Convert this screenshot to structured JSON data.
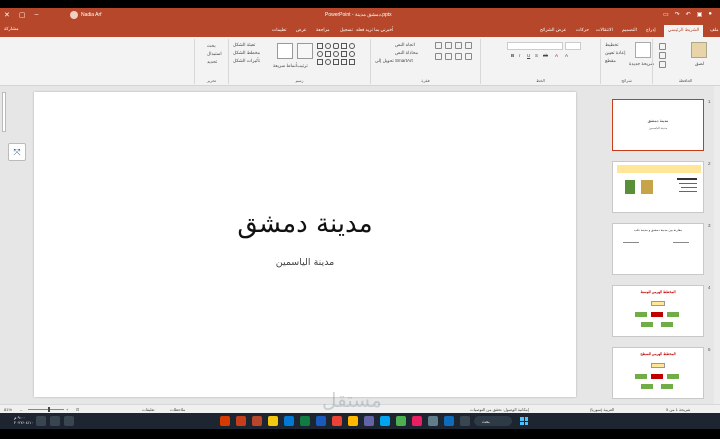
{
  "window": {
    "title": "PowerPoint - دمشق مدينة.pptx",
    "user_name": "Nadia Arf",
    "qat_icons": [
      "autosave-icon",
      "save-icon",
      "undo-icon",
      "redo-icon",
      "present-icon"
    ]
  },
  "tabs": {
    "items": [
      "ملف",
      "الشريط الرئيسي",
      "إدراج",
      "التصميم",
      "الانتقالات",
      "حركات",
      "عرض الشرائح",
      "تسجيل",
      "مراجعة",
      "عرض",
      "تعليمات"
    ],
    "tell_me": "أخبرني بما تريد فعله",
    "share": "مشاركة"
  },
  "ribbon": {
    "groups": [
      "الحافظة",
      "شرائح",
      "الخط",
      "فقرة",
      "رسم",
      "تحرير"
    ],
    "items": {
      "paste": "لصق",
      "new_slide": "شريحة جديدة",
      "layout": "تخطيط",
      "reset": "إعادة تعيين",
      "section": "مقطع",
      "find": "بحث",
      "replace": "استبدال",
      "select": "تحديد",
      "arrange": "ترتيب",
      "quick_styles": "أنماط سريعة",
      "shape_fill": "تعبئة الشكل",
      "shape_outline": "مخطط الشكل",
      "shape_effects": "تأثيرات الشكل",
      "text_direction": "اتجاه النص",
      "align_text": "محاذاة النص",
      "smartart": "تحويل إلى SmartArt"
    }
  },
  "slide": {
    "title": "مدينة دمشق",
    "subtitle": "مدينة الياسمين"
  },
  "thumbnails": [
    {
      "number": "1",
      "title": "مدينة دمشق",
      "subtitle": "مدينة الياسمين"
    },
    {
      "number": "2",
      "title": ""
    },
    {
      "number": "3",
      "title": "مقارنة بين مدينة دمشق و مدينة حلب"
    },
    {
      "number": "4",
      "title": "المخطط الهرمي للوسط"
    },
    {
      "number": "5",
      "title": "المخطط الهرمي للسطح"
    }
  ],
  "statusbar": {
    "slide_info": "شريحة 1 من 5",
    "language": "العربية (سوريا)",
    "accessibility": "إمكانية الوصول: تحقق من التوصيات",
    "notes": "ملاحظات",
    "comments": "تعليقات",
    "zoom": "81%"
  },
  "taskbar": {
    "search": "بحث",
    "time": "٩:٠٠ م",
    "date": "٢٠٢٢/٠٤/١٠"
  },
  "watermark": "مستقل",
  "colors": {
    "accent": "#b7472a",
    "selection": "#c43e1c",
    "taskbar": "#1c2530"
  }
}
